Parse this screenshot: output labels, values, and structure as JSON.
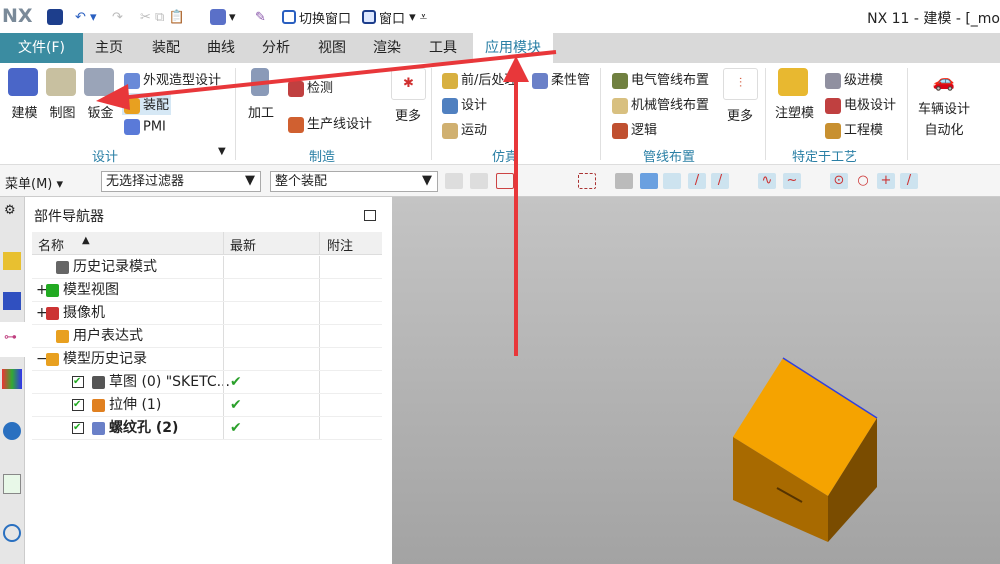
{
  "titlebar": {
    "logo": "NX",
    "switch_window": "切换窗口",
    "window": "窗口",
    "title": "NX 11 - 建模 - [_mo"
  },
  "tabs": {
    "file": "文件(F)",
    "items": [
      "主页",
      "装配",
      "曲线",
      "分析",
      "视图",
      "渲染",
      "工具",
      "应用模块"
    ],
    "active": "应用模块"
  },
  "ribbon": {
    "design": {
      "items": [
        "建模",
        "制图",
        "钣金"
      ],
      "small": [
        "外观造型设计",
        "装配",
        "PMI"
      ],
      "group": "设计"
    },
    "manufacturing": {
      "machining": "加工",
      "small": [
        "检测",
        "生产线设计"
      ],
      "more": "更多",
      "group": "制造"
    },
    "simulation": {
      "small": [
        "前/后处理",
        "设计",
        "运动"
      ],
      "flex": "柔性管",
      "group": "仿真"
    },
    "routing": {
      "small": [
        "电气管线布置",
        "机械管线布置",
        "逻辑"
      ],
      "more": "更多",
      "group": "管线布置"
    },
    "process": {
      "mold": "注塑模",
      "small": [
        "级进模",
        "电极设计",
        "工程模"
      ],
      "group": "特定于工艺"
    },
    "vehicle": {
      "label1": "车辆设计",
      "label2": "自动化"
    }
  },
  "toolbar": {
    "menu": "菜单(M)",
    "filter": "无选择过滤器",
    "scope": "整个装配"
  },
  "navigator": {
    "title": "部件导航器",
    "columns": [
      "名称",
      "最新",
      "附注"
    ],
    "rows": [
      {
        "name": "历史记录模式",
        "latest": "",
        "expand": "",
        "bold": false
      },
      {
        "name": "模型视图",
        "latest": "",
        "expand": "+",
        "bold": false
      },
      {
        "name": "摄像机",
        "latest": "",
        "expand": "+",
        "bold": false
      },
      {
        "name": "用户表达式",
        "latest": "",
        "expand": "",
        "bold": false
      },
      {
        "name": "模型历史记录",
        "latest": "",
        "expand": "−",
        "bold": false
      },
      {
        "name": "草图 (0) \"SKETC...",
        "latest": "✔",
        "expand": "",
        "bold": false
      },
      {
        "name": "拉伸 (1)",
        "latest": "✔",
        "expand": "",
        "bold": false
      },
      {
        "name": "螺纹孔 (2)",
        "latest": "✔",
        "expand": "",
        "bold": true
      }
    ]
  },
  "colors": {
    "file_tab": "#3b8ca1",
    "accent": "#2a7fa5",
    "cube": "#f5a300",
    "annotation": "#e8373a"
  }
}
